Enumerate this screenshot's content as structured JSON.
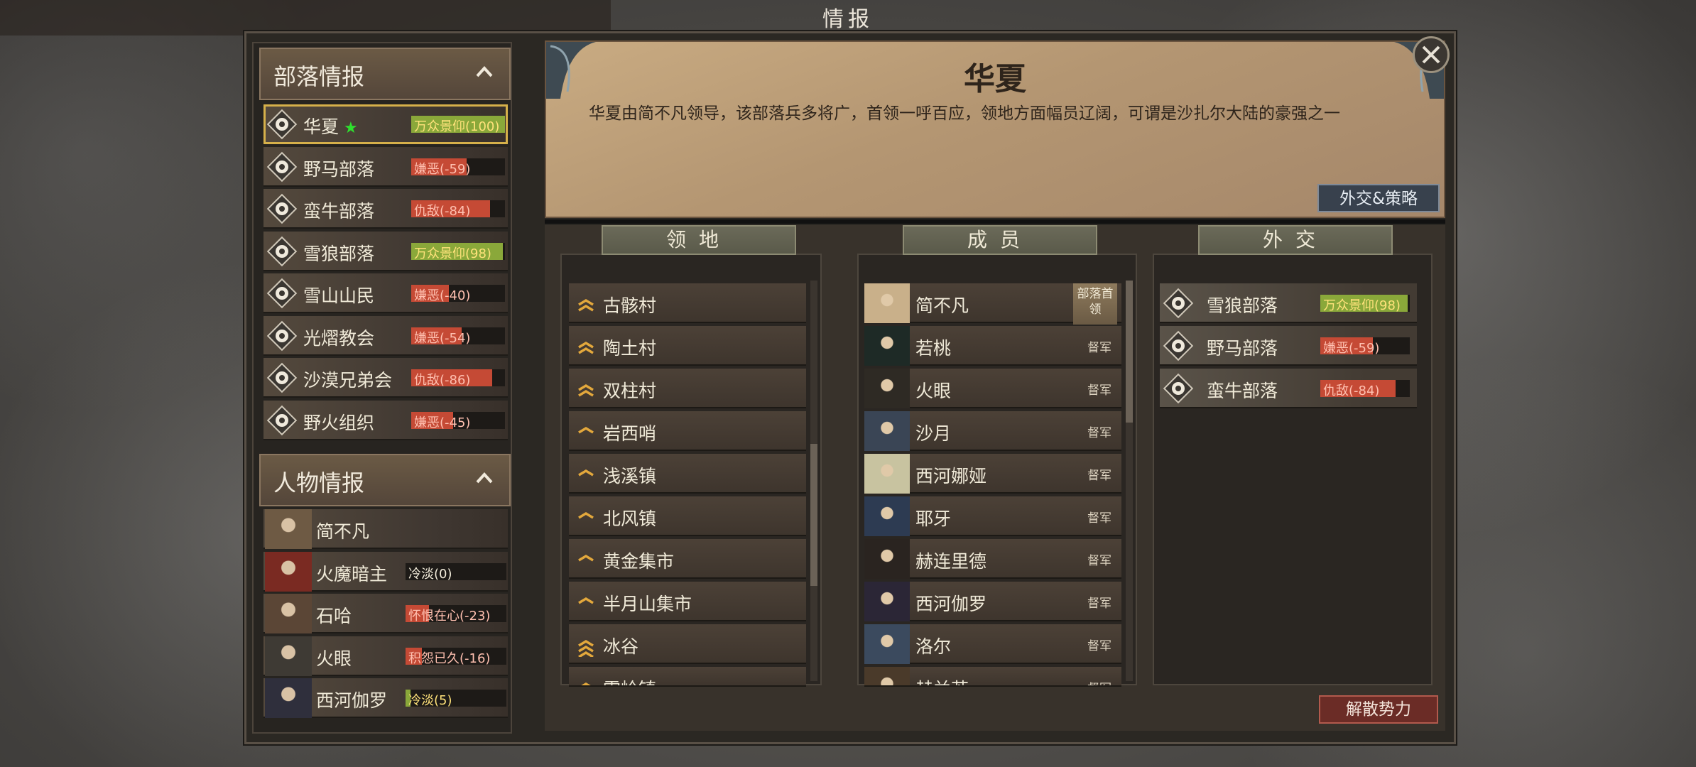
{
  "window_title": "情报",
  "tribe_section": {
    "title": "部落情报",
    "items": [
      {
        "name": "华夏",
        "relation": "万众景仰(100)",
        "value": 100,
        "tone": "positive",
        "selected": true,
        "star": "★"
      },
      {
        "name": "野马部落",
        "relation": "嫌恶(-59)",
        "value": -59,
        "tone": "negative"
      },
      {
        "name": "蛮牛部落",
        "relation": "仇敌(-84)",
        "value": -84,
        "tone": "negative"
      },
      {
        "name": "雪狼部落",
        "relation": "万众景仰(98)",
        "value": 98,
        "tone": "positive"
      },
      {
        "name": "雪山山民",
        "relation": "嫌恶(-40)",
        "value": -40,
        "tone": "negative"
      },
      {
        "name": "光熠教会",
        "relation": "嫌恶(-54)",
        "value": -54,
        "tone": "negative"
      },
      {
        "name": "沙漠兄弟会",
        "relation": "仇敌(-86)",
        "value": -86,
        "tone": "negative"
      },
      {
        "name": "野火组织",
        "relation": "嫌恶(-45)",
        "value": -45,
        "tone": "negative"
      }
    ]
  },
  "person_section": {
    "title": "人物情报",
    "items": [
      {
        "name": "简不凡",
        "relation": ""
      },
      {
        "name": "火魔暗主",
        "relation": "冷淡(0)",
        "value": 0,
        "tone": "neutral"
      },
      {
        "name": "石哈",
        "relation": "怀恨在心(-23)",
        "value": -23,
        "tone": "negative"
      },
      {
        "name": "火眼",
        "relation": "积怨已久(-16)",
        "value": -16,
        "tone": "negative"
      },
      {
        "name": "西河伽罗",
        "relation": "冷淡(5)",
        "value": 5,
        "tone": "positive"
      }
    ]
  },
  "faction": {
    "name": "华夏",
    "description": "华夏由简不凡领导，该部落兵多将广，首领一呼百应，领地方面幅员辽阔，可谓是沙扎尔大陆的豪强之一",
    "diplomacy_button": "外交&策略"
  },
  "territory": {
    "title": "领地",
    "items": [
      {
        "name": "古骸村",
        "rank": "double"
      },
      {
        "name": "陶土村",
        "rank": "double"
      },
      {
        "name": "双柱村",
        "rank": "double"
      },
      {
        "name": "岩西哨",
        "rank": "single"
      },
      {
        "name": "浅溪镇",
        "rank": "single"
      },
      {
        "name": "北风镇",
        "rank": "single"
      },
      {
        "name": "黄金集市",
        "rank": "single"
      },
      {
        "name": "半月山集市",
        "rank": "single"
      },
      {
        "name": "冰谷",
        "rank": "triple"
      },
      {
        "name": "雪岭镇",
        "rank": "single"
      }
    ]
  },
  "members": {
    "title": "成员",
    "leader_badge": "部落首领",
    "items": [
      {
        "name": "简不凡",
        "role": "",
        "leader": true
      },
      {
        "name": "若桃",
        "role": "督军"
      },
      {
        "name": "火眼",
        "role": "督军"
      },
      {
        "name": "沙月",
        "role": "督军"
      },
      {
        "name": "西河娜娅",
        "role": "督军"
      },
      {
        "name": "耶牙",
        "role": "督军"
      },
      {
        "name": "赫连里德",
        "role": "督军"
      },
      {
        "name": "西河伽罗",
        "role": "督军"
      },
      {
        "name": "洛尔",
        "role": "督军"
      },
      {
        "name": "赫兰若",
        "role": "督军"
      }
    ]
  },
  "diplomacy": {
    "title": "外交",
    "items": [
      {
        "name": "雪狼部落",
        "relation": "万众景仰(98)",
        "value": 98,
        "tone": "positive"
      },
      {
        "name": "野马部落",
        "relation": "嫌恶(-59)",
        "value": -59,
        "tone": "negative"
      },
      {
        "name": "蛮牛部落",
        "relation": "仇敌(-84)",
        "value": -84,
        "tone": "negative"
      }
    ]
  },
  "disband_button": "解散势力",
  "colors": {
    "positive": "#8aa83a",
    "negative": "#c54a35",
    "selected_outline": "#d6b04a",
    "star": "#2ee02e"
  },
  "icons": {
    "tribe_emblems": [
      "sun-emblem-icon",
      "horse-head-icon",
      "bull-head-icon",
      "wolf-head-icon",
      "mountain-icon",
      "flame-cross-icon",
      "crossed-swords-icon",
      "fire-icon"
    ],
    "close": "close-icon",
    "collapse": "chevron-up-icon"
  }
}
